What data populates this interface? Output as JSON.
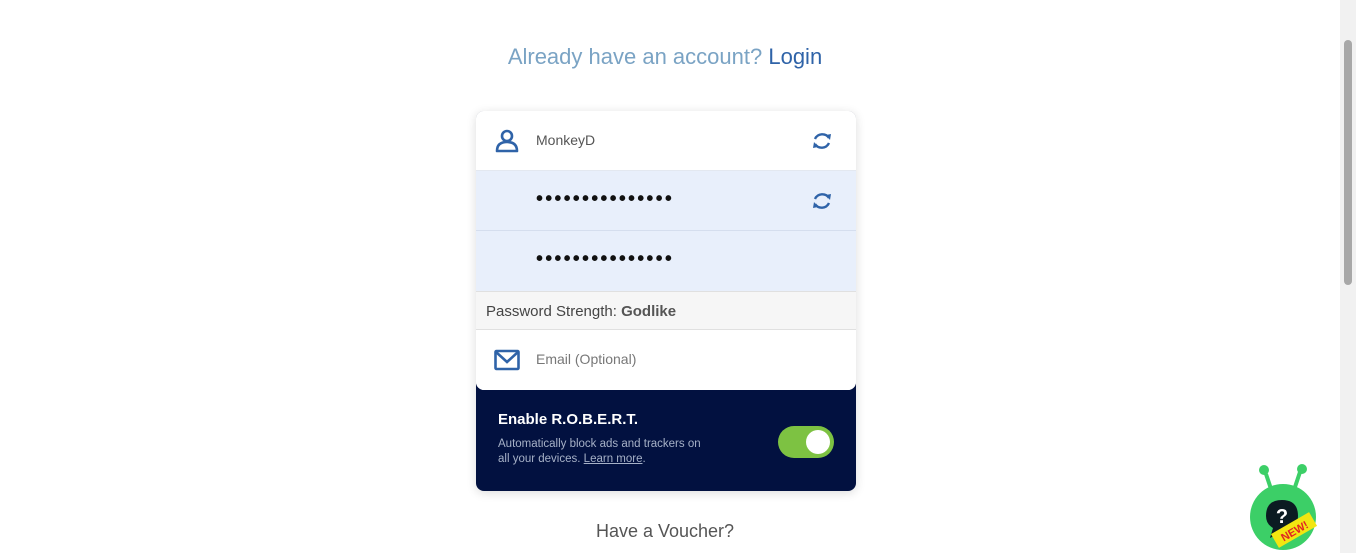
{
  "header": {
    "question": "Already have an account?",
    "login_label": "Login"
  },
  "form": {
    "username_value": "MonkeyD",
    "password_mask": "•••••••••••••••",
    "confirm_password_mask": "•••••••••••••••",
    "strength_label": "Password Strength:",
    "strength_value": "Godlike",
    "email_placeholder": "Email (Optional)"
  },
  "robert": {
    "title": "Enable R.O.B.E.R.T.",
    "description": "Automatically block ads and trackers on all your devices.",
    "learn_more": "Learn more",
    "enabled": true
  },
  "footer": {
    "voucher_label": "Have a Voucher?"
  },
  "help_widget": {
    "badge": "NEW!",
    "symbol": "?"
  },
  "colors": {
    "accent": "#2f63a8",
    "dark_panel": "#021140",
    "toggle_on": "#7dc242",
    "password_bg": "#e8effb"
  },
  "icons": {
    "username": "user-icon",
    "regenerate": "refresh-icon",
    "email": "mail-icon"
  }
}
